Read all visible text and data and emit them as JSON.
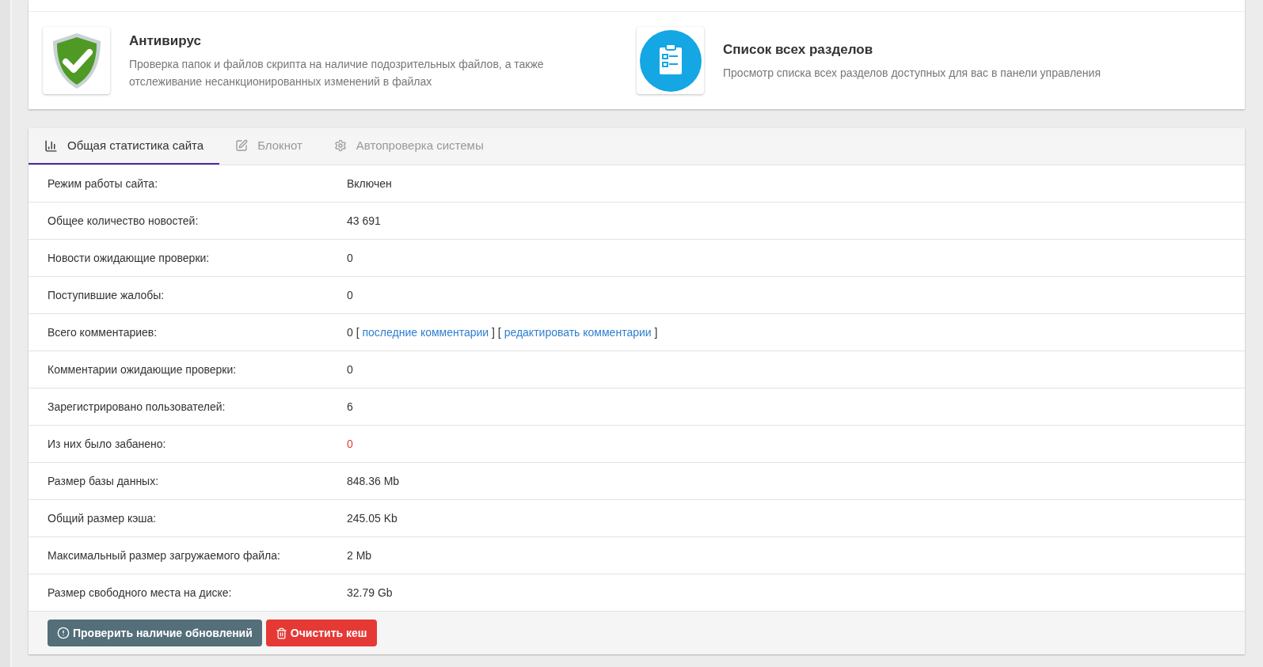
{
  "cards": [
    {
      "kind": "shield",
      "title": "Антивирус",
      "description": "Проверка папок и файлов скрипта на наличие подозрительных файлов, а также отслеживание несанкционированных изменений в файлах"
    },
    {
      "kind": "clipboard",
      "title": "Список всех разделов",
      "description": "Просмотр списка всех разделов доступных для вас в панели управления"
    }
  ],
  "tabs": [
    {
      "label": "Общая статистика сайта",
      "kind": "chart",
      "selected": true
    },
    {
      "label": "Блокнот",
      "kind": "edit",
      "selected": false
    },
    {
      "label": "Автопроверка системы",
      "kind": "gear",
      "selected": false
    }
  ],
  "rows": [
    {
      "label": "Режим работы сайта:",
      "value": [
        {
          "kind": "text",
          "text": "Включен"
        }
      ]
    },
    {
      "label": "Общее количество новостей:",
      "value": [
        {
          "kind": "text",
          "text": "43 691"
        }
      ]
    },
    {
      "label": "Новости ожидающие проверки:",
      "value": [
        {
          "kind": "text",
          "text": "0"
        }
      ]
    },
    {
      "label": "Поступившие жалобы:",
      "value": [
        {
          "kind": "text",
          "text": "0"
        }
      ]
    },
    {
      "label": "Всего комментариев:",
      "value": [
        {
          "kind": "text",
          "text": "0 [ "
        },
        {
          "kind": "link",
          "text": "последние комментарии"
        },
        {
          "kind": "text",
          "text": " ] [ "
        },
        {
          "kind": "link",
          "text": "редактировать комментарии"
        },
        {
          "kind": "text",
          "text": " ]"
        }
      ]
    },
    {
      "label": "Комментарии ожидающие проверки:",
      "value": [
        {
          "kind": "text",
          "text": "0"
        }
      ]
    },
    {
      "label": "Зарегистрировано пользователей:",
      "value": [
        {
          "kind": "text",
          "text": "6"
        }
      ]
    },
    {
      "label": "Из них было забанено:",
      "value": [
        {
          "kind": "alert",
          "text": "0"
        }
      ]
    },
    {
      "label": "Размер базы данных:",
      "value": [
        {
          "kind": "text",
          "text": "848.36 Mb"
        }
      ]
    },
    {
      "label": "Общий размер кэша:",
      "value": [
        {
          "kind": "text",
          "text": "245.05 Kb"
        }
      ]
    },
    {
      "label": "Максимальный размер загружаемого файла:",
      "value": [
        {
          "kind": "text",
          "text": "2 Mb"
        }
      ]
    },
    {
      "label": "Размер свободного места на диске:",
      "value": [
        {
          "kind": "text",
          "text": "32.79 Gb"
        }
      ]
    }
  ],
  "buttons": [
    {
      "label": "Проверить наличие обновлений",
      "kind": "info"
    },
    {
      "label": "Очистить кеш",
      "kind": "danger"
    }
  ]
}
